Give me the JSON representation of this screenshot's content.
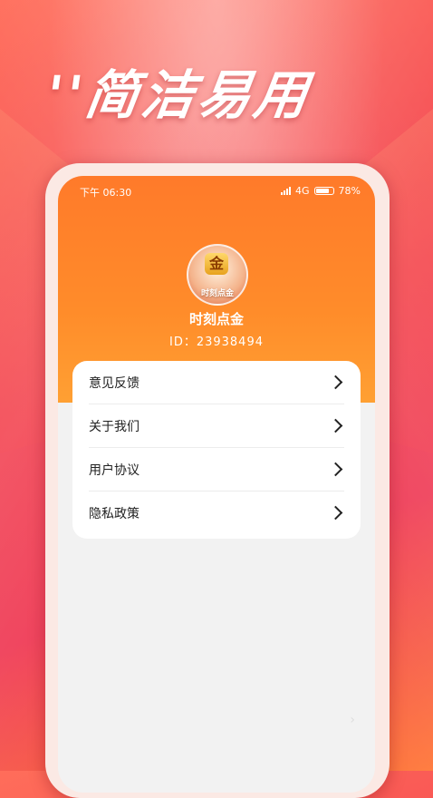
{
  "promo": {
    "headline": "''简洁易用"
  },
  "status_bar": {
    "time": "下午 06:30",
    "network": "4G",
    "battery": "78%"
  },
  "profile": {
    "avatar_text": "金",
    "avatar_caption": "时刻点金",
    "app_name": "时刻点金",
    "user_id": "ID：23938494"
  },
  "menu": {
    "items": [
      {
        "label": "意见反馈"
      },
      {
        "label": "关于我们"
      },
      {
        "label": "用户协议"
      },
      {
        "label": "隐私政策"
      }
    ]
  },
  "colors": {
    "header_orange": "#ff7a2a",
    "background_red": "#f2404f"
  }
}
